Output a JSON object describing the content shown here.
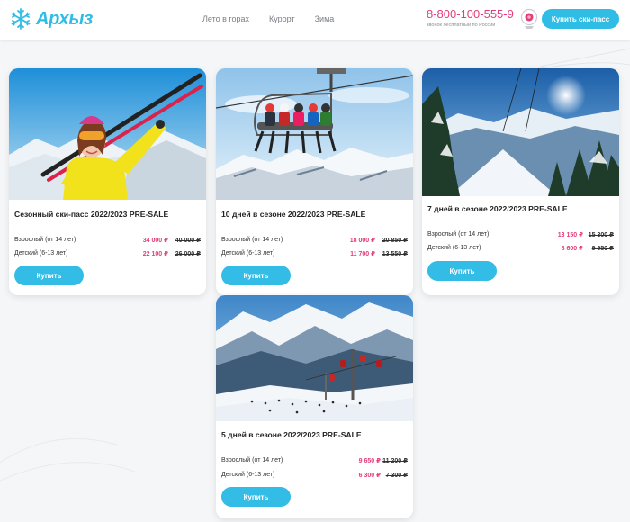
{
  "header": {
    "logo_text": "Архыз",
    "nav": [
      "Лето в горах",
      "Курорт",
      "Зима"
    ],
    "phone": "8-800-100-555-9",
    "phone_note": "звонок бесплатный по России",
    "cta_label": "Купить ски-пасс"
  },
  "colors": {
    "accent": "#2fbde6",
    "price_new": "#e23d7a"
  },
  "cards": [
    {
      "title": "Сезонный ски-пасс 2022/2023 PRE-SALE",
      "image": "skier-woman-photo",
      "adult_label": "Взрослый (от 14 лет)",
      "adult_price": "34 000 ₽",
      "adult_old": "40 000 ₽",
      "child_label": "Детский (6-13 лет)",
      "child_price": "22 100 ₽",
      "child_old": "26 000 ₽",
      "button": "Купить"
    },
    {
      "title": "10 дней в сезоне 2022/2023 PRE-SALE",
      "image": "chairlift-photo",
      "adult_label": "Взрослый (от 14 лет)",
      "adult_price": "18 000 ₽",
      "adult_old": "20 850 ₽",
      "child_label": "Детский (6-13 лет)",
      "child_price": "11 700 ₽",
      "child_old": "13 550 ₽",
      "button": "Купить"
    },
    {
      "title": "7 дней в сезоне 2022/2023 PRE-SALE",
      "image": "snowy-forest-photo",
      "adult_label": "Взрослый (от 14 лет)",
      "adult_price": "13 150 ₽",
      "adult_old": "15 300 ₽",
      "child_label": "Детский (6-13 лет)",
      "child_price": "8 600 ₽",
      "child_old": "9 950 ₽",
      "button": "Купить"
    },
    {
      "title": "5 дней в сезоне 2022/2023 PRE-SALE",
      "image": "ski-slope-gondola-photo",
      "adult_label": "Взрослый (от 14 лет)",
      "adult_price": "9 650 ₽",
      "adult_old": "11 200 ₽",
      "child_label": "Детский (6-13 лет)",
      "child_price": "6 300 ₽",
      "child_old": "7 300 ₽",
      "button": "Купить"
    }
  ]
}
